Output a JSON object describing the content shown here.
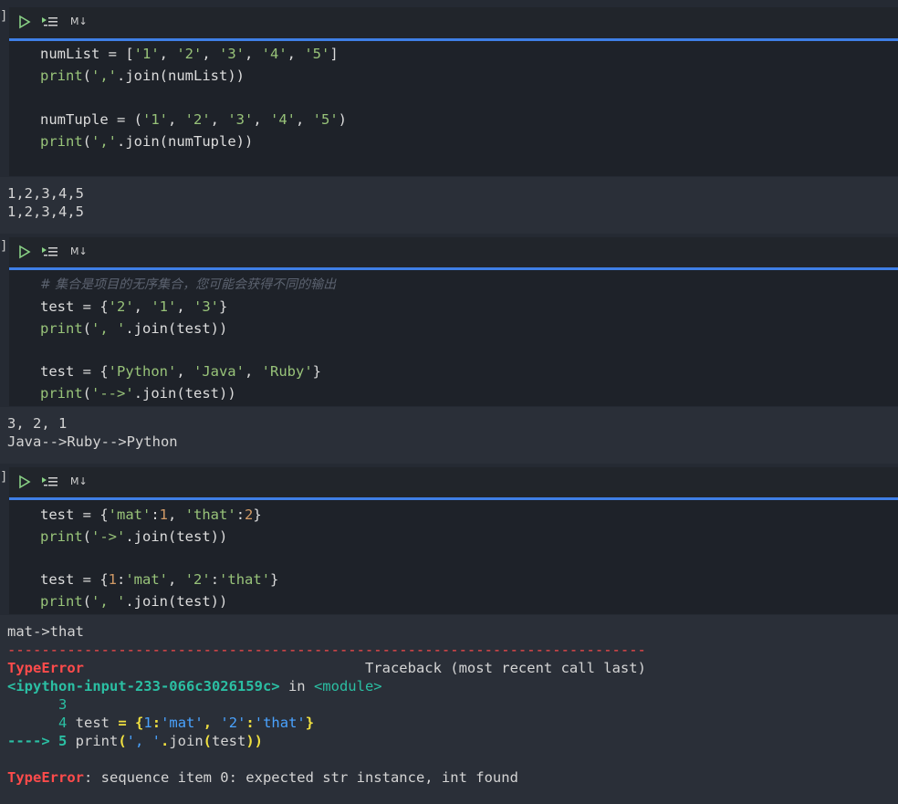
{
  "toolbar": {
    "md_label": "M↓"
  },
  "cells": [
    {
      "code": [
        "numList = ['1', '2', '3', '4', '5']",
        "print(','.join(numList))",
        "",
        "numTuple = ('1', '2', '3', '4', '5')",
        "print(','.join(numTuple))"
      ],
      "output": [
        "1,2,3,4,5",
        "1,2,3,4,5"
      ]
    },
    {
      "code": [
        "# 集合是项目的无序集合，您可能会获得不同的输出",
        "test = {'2', '1', '3'}",
        "print(', '.join(test))",
        "",
        "test = {'Python', 'Java', 'Ruby'}",
        "print('-->'.join(test))"
      ],
      "output": [
        "3, 2, 1",
        "Java-->Ruby-->Python"
      ]
    },
    {
      "code": [
        "test = {'mat':1, 'that':2}",
        "print('->'.join(test))",
        "",
        "test = {1:'mat', '2':'that'}",
        "print(', '.join(test))"
      ],
      "output": [
        "mat->that",
        "---------------------------------------------------------------------------",
        "TypeError                                 Traceback (most recent call last)",
        "<ipython-input-233-066c3026159c> in <module>",
        "      3",
        "      4 test = {1:'mat', '2':'that'}",
        "----> 5 print(', '.join(test))",
        "",
        "TypeError: sequence item 0: expected str instance, int found"
      ]
    }
  ],
  "colors": {
    "accent": "#3f7fe6",
    "error": "#ff4b4b",
    "string": "#98c379",
    "number": "#d19a66",
    "teal": "#2bbfa3"
  }
}
